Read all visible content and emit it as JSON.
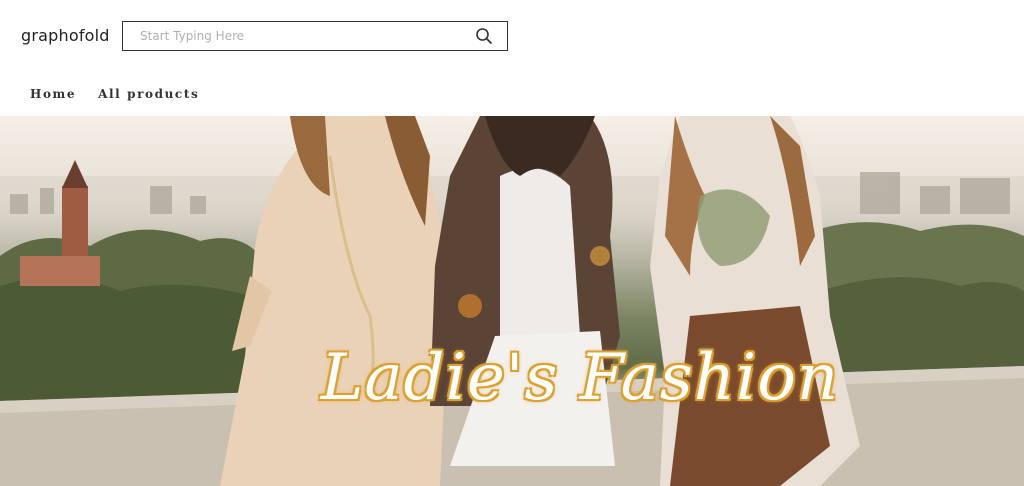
{
  "header": {
    "logo_text": "graphofold",
    "search": {
      "placeholder": "Start Typing Here",
      "icon": "search-icon"
    }
  },
  "nav": {
    "items": [
      {
        "label": "Home"
      },
      {
        "label": "All products"
      }
    ]
  },
  "hero": {
    "title": "Ladie's Fashion",
    "title_color": "#ffffff",
    "title_glow": "#d99c2b"
  }
}
